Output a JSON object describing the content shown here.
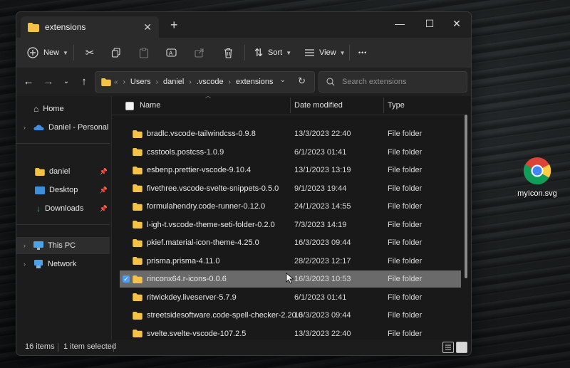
{
  "window": {
    "tab_title": "extensions",
    "new_tab_glyph": "+",
    "close_tab_glyph": "✕",
    "controls": {
      "minimize": "—",
      "maximize": "☐",
      "close": "✕"
    }
  },
  "toolbar": {
    "new_label": "New",
    "sort_label": "Sort",
    "view_label": "View",
    "more_glyph": "•••",
    "icons": [
      "add-icon",
      "cut-icon",
      "copy-icon",
      "paste-icon",
      "rename-icon",
      "share-icon",
      "delete-icon",
      "sort-icon",
      "view-icon",
      "more-icon"
    ]
  },
  "address": {
    "breadcrumb": [
      "Users",
      "daniel",
      ".vscode",
      "extensions"
    ],
    "overflow_glyph": "«",
    "search_placeholder": "Search extensions"
  },
  "nav_pane": {
    "home": "Home",
    "onedrive": "Daniel - Personal",
    "quick_access": [
      {
        "label": "daniel",
        "icon": "folder-icon"
      },
      {
        "label": "Desktop",
        "icon": "desktop-icon"
      },
      {
        "label": "Downloads",
        "icon": "download-icon"
      }
    ],
    "this_pc": "This PC",
    "network": "Network"
  },
  "columns": {
    "name": "Name",
    "date": "Date modified",
    "type": "Type"
  },
  "files": [
    {
      "name": "bradlc.vscode-tailwindcss-0.9.8",
      "date": "13/3/2023 22:40",
      "type": "File folder"
    },
    {
      "name": "csstools.postcss-1.0.9",
      "date": "6/1/2023 01:41",
      "type": "File folder"
    },
    {
      "name": "esbenp.prettier-vscode-9.10.4",
      "date": "13/1/2023 13:19",
      "type": "File folder"
    },
    {
      "name": "fivethree.vscode-svelte-snippets-0.5.0",
      "date": "9/1/2023 19:44",
      "type": "File folder"
    },
    {
      "name": "formulahendry.code-runner-0.12.0",
      "date": "24/1/2023 14:55",
      "type": "File folder"
    },
    {
      "name": "l-igh-t.vscode-theme-seti-folder-0.2.0",
      "date": "7/3/2023 14:19",
      "type": "File folder"
    },
    {
      "name": "pkief.material-icon-theme-4.25.0",
      "date": "16/3/2023 09:44",
      "type": "File folder"
    },
    {
      "name": "prisma.prisma-4.11.0",
      "date": "28/2/2023 12:17",
      "type": "File folder"
    },
    {
      "name": "rinconx64.r-icons-0.0.6",
      "date": "16/3/2023 10:53",
      "type": "File folder",
      "selected": true
    },
    {
      "name": "ritwickdey.liveserver-5.7.9",
      "date": "6/1/2023 01:41",
      "type": "File folder"
    },
    {
      "name": "streetsidesoftware.code-spell-checker-2.20.0",
      "date": "16/3/2023 09:44",
      "type": "File folder"
    },
    {
      "name": "svelte.svelte-vscode-107.2.5",
      "date": "13/3/2023 22:40",
      "type": "File folder"
    }
  ],
  "status": {
    "items_count": "16 items",
    "selected": "1 item selected"
  },
  "desktop": {
    "icon_label": "myIcon.svg"
  },
  "colors": {
    "folder": "#f3c247",
    "accent": "#4d9ef8",
    "selection": "#6a6a6a"
  }
}
